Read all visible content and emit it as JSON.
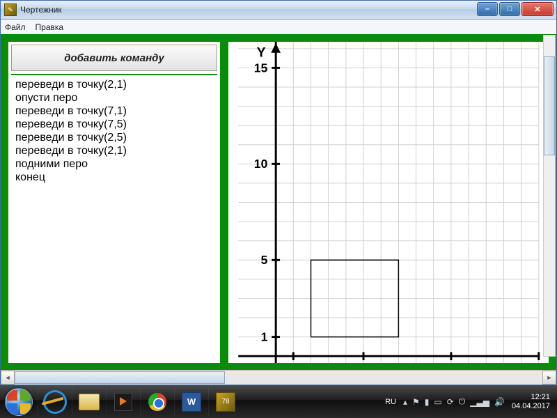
{
  "window": {
    "title": "Чертежник",
    "menu": {
      "file": "Файл",
      "edit": "Правка"
    },
    "btn_min": "–",
    "btn_max": "□",
    "btn_close": "✕"
  },
  "left": {
    "add_button": "добавить команду",
    "code": [
      "переведи в точку(2,1)",
      "опусти перо",
      "переведи в точку(7,1)",
      "переведи в точку(7,5)",
      "переведи в точку(2,5)",
      "переведи в точку(2,1)",
      "подними перо",
      "конец"
    ]
  },
  "chart_data": {
    "type": "line",
    "title": "",
    "xlabel": "",
    "ylabel": "Y",
    "xlim": [
      0,
      15
    ],
    "ylim": [
      0,
      16
    ],
    "x_ticks": [
      1,
      5,
      10,
      15
    ],
    "y_ticks": [
      1,
      5,
      10,
      15
    ],
    "grid_step": 1,
    "series": [
      {
        "name": "rectangle",
        "x": [
          2,
          7,
          7,
          2,
          2
        ],
        "y": [
          1,
          1,
          5,
          5,
          1
        ]
      }
    ]
  },
  "taskbar": {
    "lang": "RU",
    "time": "12:21",
    "date": "04.04.2017",
    "word_glyph": "W",
    "app_glyph": "78"
  }
}
